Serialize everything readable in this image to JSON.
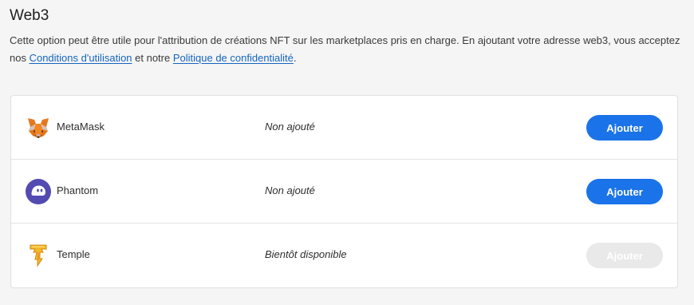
{
  "section": {
    "title": "Web3",
    "description_part1": "Cette option peut être utile pour l'attribution de créations NFT sur les marketplaces pris en charge. En ajoutant votre adresse web3, vous acceptez nos ",
    "terms_link": "Conditions d'utilisation",
    "description_part2": " et notre ",
    "privacy_link": "Politique de confidentialité",
    "description_part3": "."
  },
  "wallets": [
    {
      "name": "MetaMask",
      "status": "Non ajouté",
      "button_label": "Ajouter",
      "button_enabled": true,
      "icon": "metamask-fox-icon"
    },
    {
      "name": "Phantom",
      "status": "Non ajouté",
      "button_label": "Ajouter",
      "button_enabled": true,
      "icon": "phantom-ghost-icon"
    },
    {
      "name": "Temple",
      "status": "Bientôt disponible",
      "button_label": "Ajouter",
      "button_enabled": false,
      "icon": "temple-logo-icon"
    }
  ],
  "colors": {
    "accent": "#1a73e8",
    "link": "#1565c0",
    "disabled_button": "#e9e9e9",
    "phantom_purple": "#534bb1",
    "metamask_orange": "#e2761b",
    "temple_gold": "#f5b72a"
  }
}
